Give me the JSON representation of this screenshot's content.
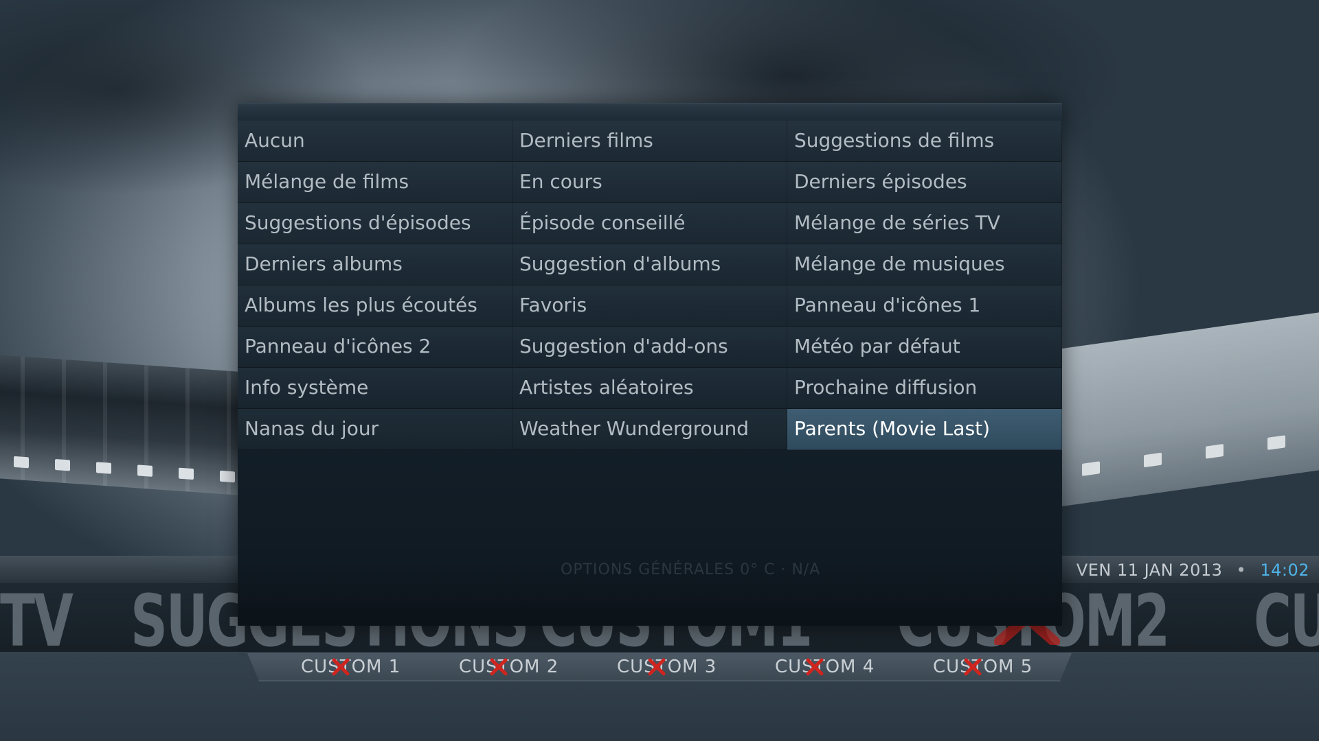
{
  "dialog": {
    "items": [
      [
        "Aucun",
        "Derniers films",
        "Suggestions de films"
      ],
      [
        "Mélange de films",
        "En cours",
        "Derniers épisodes"
      ],
      [
        "Suggestions d'épisodes",
        "Épisode conseillé",
        "Mélange de séries TV"
      ],
      [
        "Derniers albums",
        "Suggestion d'albums",
        "Mélange de musiques"
      ],
      [
        "Albums les plus écoutés",
        "Favoris",
        "Panneau d'icônes 1"
      ],
      [
        "Panneau d'icônes 2",
        "Suggestion d'add-ons",
        "Météo par défaut"
      ],
      [
        "Info système",
        "Artistes aléatoires",
        "Prochaine diffusion"
      ],
      [
        "Nanas du jour",
        "Weather Wunderground",
        "Parents (Movie Last)"
      ]
    ],
    "selected": "Parents (Movie Last)",
    "footer_hint": "OPTIONS GÉNÉRALES    0° C · N/A"
  },
  "infobar": {
    "date": "VEN 11 JAN 2013",
    "separator": "•",
    "time": "14:02"
  },
  "main_menu": [
    "TV",
    "SUGGESTIONS",
    "CUSTOM1",
    "CUSTOM2",
    "CU"
  ],
  "sub_menu": [
    "CUSTOM 1",
    "CUSTOM 2",
    "CUSTOM 3",
    "CUSTOM 4",
    "CUSTOM 5"
  ],
  "colors": {
    "accent": "#4fb3e8",
    "selected_bg": "#3f5d72",
    "mark": "#d0241e"
  }
}
